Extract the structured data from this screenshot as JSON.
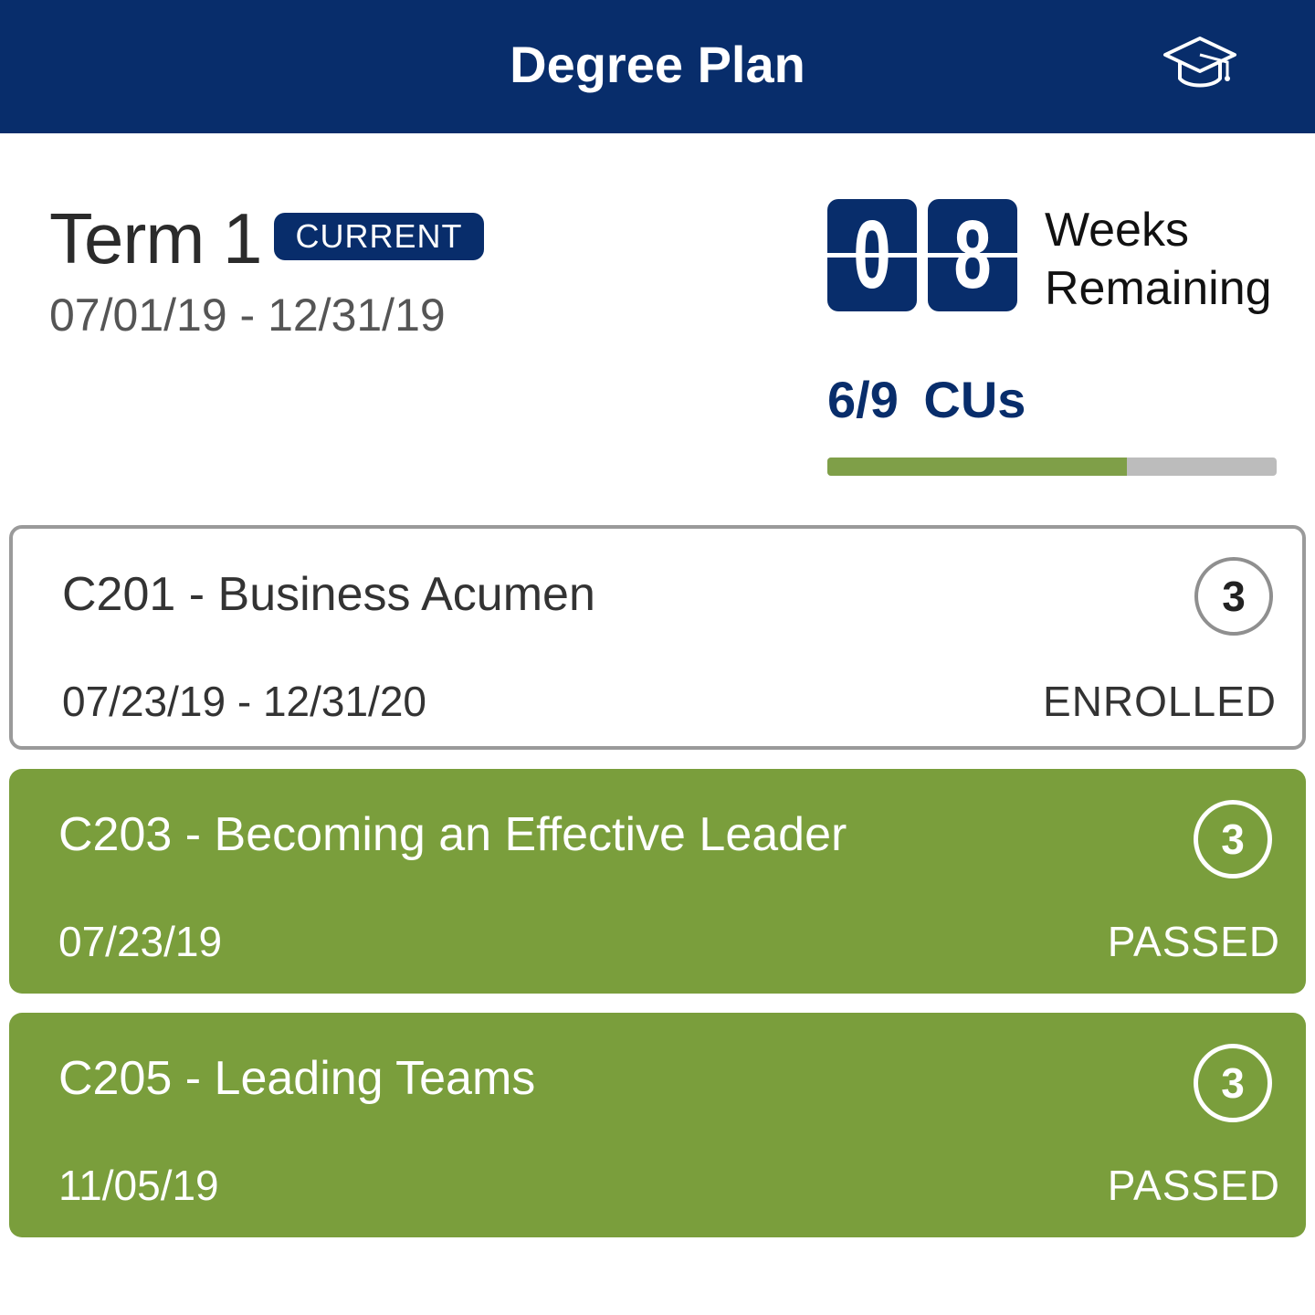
{
  "header": {
    "title": "Degree Plan",
    "icon": "graduation-cap-icon",
    "color": "#082d6b"
  },
  "term": {
    "title": "Term 1",
    "badge": "CURRENT",
    "dates": "07/01/19 - 12/31/19",
    "weeks_remaining_digits": [
      "0",
      "8"
    ],
    "weeks_label_line1": "Weeks",
    "weeks_label_line2": "Remaining",
    "cus_label": "6/9 CUs",
    "cus_completed": 6,
    "cus_total": 9
  },
  "courses": [
    {
      "name": "C201 - Business Acumen",
      "cus": "3",
      "dates": "07/23/19 - 12/31/20",
      "status": "ENROLLED"
    },
    {
      "name": "C203 - Becoming an Effective Leader",
      "cus": "3",
      "dates": "07/23/19",
      "status": "PASSED"
    },
    {
      "name": "C205 - Leading Teams",
      "cus": "3",
      "dates": "11/05/19",
      "status": "PASSED"
    }
  ],
  "colors": {
    "passed": "#7a9e3c",
    "progress_fill": "#7f9f48",
    "progress_track": "#bcbcbc"
  }
}
